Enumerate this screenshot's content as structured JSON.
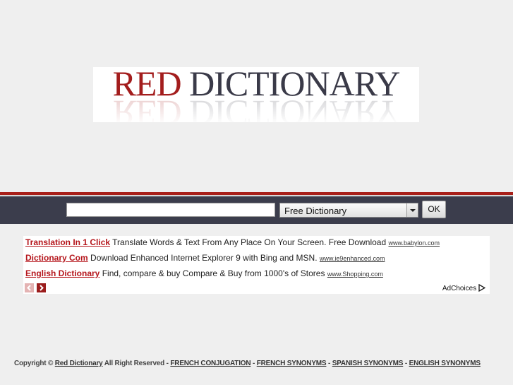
{
  "logo": {
    "word_red": "RED",
    "word_dark": "DICTIONARY",
    "colors": {
      "red": "#a31d1d",
      "dark": "#3a3a48"
    }
  },
  "search": {
    "input_value": "",
    "select_value": "Free Dictionary",
    "ok_label": "OK",
    "band_color": "#3b3d4c",
    "accent_color": "#a8201a"
  },
  "ads": [
    {
      "title": "Translation In 1 Click",
      "desc": "Translate Words & Text From Any Place On Your Screen. Free Download",
      "url": "www.babylon.com"
    },
    {
      "title": "Dictionary Com",
      "desc": "Download Enhanced Internet Explorer 9 with Bing and MSN.",
      "url": "www.ie9enhanced.com"
    },
    {
      "title": "English Dictionary",
      "desc": "Find, compare & buy Compare & Buy from 1000's of Stores",
      "url": "www.Shopping.com"
    }
  ],
  "ad_nav": {
    "prev_icon": "chevron-left-icon",
    "next_icon": "chevron-right-icon"
  },
  "adchoices_label": "AdChoices",
  "footer": {
    "copyright_prefix": "Copyright ©",
    "site_link": "Red Dictionary",
    "rights": "All Right Reserved -",
    "links": [
      "FRENCH CONJUGATION",
      "FRENCH SYNONYMS",
      "SPANISH SYNONYMS",
      "ENGLISH SYNONYMS"
    ],
    "separator": "-"
  }
}
